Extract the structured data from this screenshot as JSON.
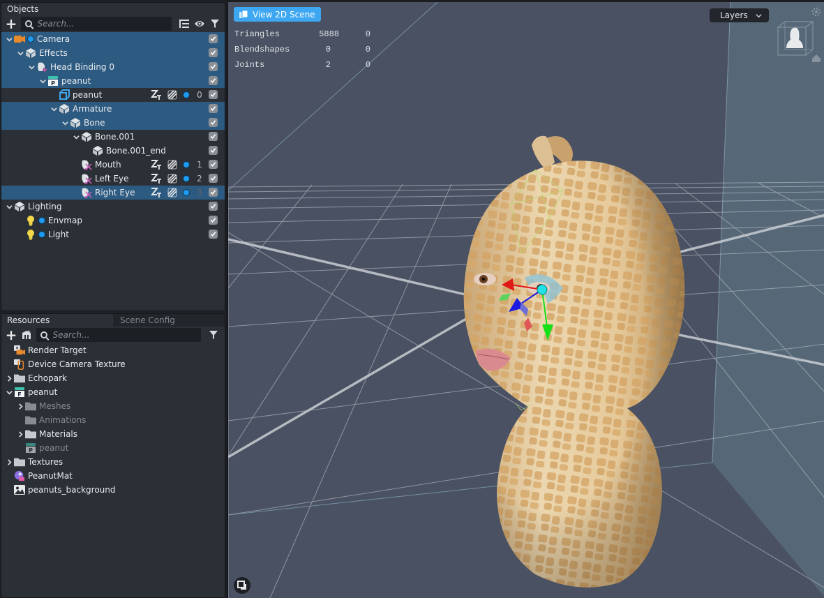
{
  "objects_panel": {
    "title": "Objects",
    "search_placeholder": "Search...",
    "items": [
      {
        "label": "Camera",
        "level": 0,
        "icon": "camera-icon",
        "expanded": true,
        "selected": true,
        "visible": true,
        "has_dot": true
      },
      {
        "label": "Effects",
        "level": 1,
        "icon": "scene-object-icon",
        "expanded": true,
        "selected": true,
        "visible": true
      },
      {
        "label": "Head Binding 0",
        "level": 2,
        "icon": "head-binding-icon",
        "expanded": true,
        "selected": true,
        "visible": true
      },
      {
        "label": "peanut",
        "level": 3,
        "icon": "prefab-icon",
        "expanded": true,
        "selected": true,
        "visible": true
      },
      {
        "label": "peanut",
        "level": 4,
        "icon": "mesh-icon",
        "selected": false,
        "visible": true,
        "layer_index": "0"
      },
      {
        "label": "Armature",
        "level": 4,
        "icon": "scene-object-icon",
        "expanded": true,
        "selected": true,
        "visible": true
      },
      {
        "label": "Bone",
        "level": 5,
        "icon": "scene-object-icon",
        "expanded": true,
        "selected": true,
        "visible": true
      },
      {
        "label": "Bone.001",
        "level": 6,
        "icon": "scene-object-icon",
        "expanded": true,
        "selected": false,
        "visible": true
      },
      {
        "label": "Bone.001_end",
        "level": 7,
        "icon": "scene-object-icon",
        "selected": false,
        "visible": true
      },
      {
        "label": "Mouth",
        "level": 6,
        "icon": "face-mask-icon",
        "selected": false,
        "visible": true,
        "layer_index": "1"
      },
      {
        "label": "Left Eye",
        "level": 6,
        "icon": "face-mask-icon",
        "selected": false,
        "visible": true,
        "layer_index": "2"
      },
      {
        "label": "Right Eye",
        "level": 6,
        "icon": "face-mask-icon",
        "selected": true,
        "visible": true,
        "layer_index": "3"
      },
      {
        "label": "Lighting",
        "level": 0,
        "icon": "scene-object-icon",
        "expanded": true,
        "selected": false,
        "visible": true
      },
      {
        "label": "Envmap",
        "level": 1,
        "icon": "light-bulb-icon",
        "selected": false,
        "visible": true,
        "has_dot": true
      },
      {
        "label": "Light",
        "level": 1,
        "icon": "light-bulb-icon",
        "selected": false,
        "visible": true,
        "has_dot": true
      }
    ]
  },
  "resources_panel": {
    "tabs": [
      {
        "label": "Resources",
        "active": true
      },
      {
        "label": "Scene Config",
        "active": false
      }
    ],
    "search_placeholder": "Search...",
    "items": [
      {
        "label": "Render Target",
        "level": 0,
        "icon": "render-target-icon"
      },
      {
        "label": "Device Camera Texture",
        "level": 0,
        "icon": "device-camera-texture-icon"
      },
      {
        "label": "Echopark",
        "level": 0,
        "icon": "folder-icon",
        "collapsed": true
      },
      {
        "label": "peanut",
        "level": 0,
        "icon": "fbx-icon",
        "expanded": true
      },
      {
        "label": "Meshes",
        "level": 1,
        "icon": "folder-icon",
        "collapsed": true,
        "dim": true
      },
      {
        "label": "Animations",
        "level": 1,
        "icon": "folder-icon",
        "dim": true
      },
      {
        "label": "Materials",
        "level": 1,
        "icon": "folder-icon",
        "collapsed": true
      },
      {
        "label": "peanut",
        "level": 1,
        "icon": "prefab-icon",
        "dim": true
      },
      {
        "label": "Textures",
        "level": 0,
        "icon": "folder-icon",
        "collapsed": true
      },
      {
        "label": "PeanutMat",
        "level": 0,
        "icon": "material-icon"
      },
      {
        "label": "peanuts_background",
        "level": 0,
        "icon": "image-icon"
      }
    ]
  },
  "viewport": {
    "view_2d_button": "View 2D Scene",
    "layers_dropdown": "Layers",
    "stats": [
      {
        "label": "Triangles",
        "value": "5888",
        "extra": "0"
      },
      {
        "label": "Blendshapes",
        "value": "0",
        "extra": "0"
      },
      {
        "label": "Joints",
        "value": "2",
        "extra": "0"
      }
    ]
  },
  "colors": {
    "selection": "#2d5a80",
    "accent_blue": "#3ea7f2",
    "viewport_bg": "#4a5162",
    "panel_bg": "#2b2f36"
  }
}
